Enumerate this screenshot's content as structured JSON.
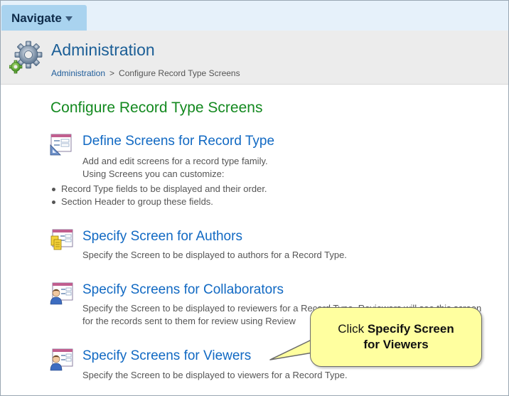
{
  "nav": {
    "label": "Navigate"
  },
  "header": {
    "title": "Administration",
    "breadcrumb_link": "Administration",
    "breadcrumb_sep": ">",
    "breadcrumb_current": "Configure Record Type Screens"
  },
  "main": {
    "section_title": "Configure Record Type Screens",
    "items": [
      {
        "title": "Define Screens for Record Type",
        "desc1": "Add and edit screens for a record type family.",
        "desc2": "Using Screens you can customize:",
        "bullets": [
          "Record Type fields to be displayed and their order.",
          "Section Header to group these fields."
        ],
        "icon": "screen-edit-icon"
      },
      {
        "title": "Specify Screen for Authors",
        "desc1": "Specify the Screen to be displayed to authors for a Record Type.",
        "icon": "authors-screen-icon"
      },
      {
        "title": "Specify Screens for Collaborators",
        "desc1": "Specify the Screen to be displayed to reviewers for a Record Type. Reviewers will see this screen",
        "desc2": "for the records sent to them for review using Review",
        "icon": "collaborators-screen-icon"
      },
      {
        "title": "Specify Screens for Viewers",
        "desc1": "Specify the Screen to be displayed to viewers for a Record Type.",
        "icon": "viewers-screen-icon"
      }
    ]
  },
  "callout": {
    "prefix": "Click ",
    "bold1": "Specify Screen",
    "bold2": "for Viewers"
  },
  "colors": {
    "title_blue": "#1b5e96",
    "link_blue": "#1169c3",
    "section_green": "#13891f",
    "callout_yellow": "#ffff9f",
    "nav_blue": "#a9d3ef"
  }
}
